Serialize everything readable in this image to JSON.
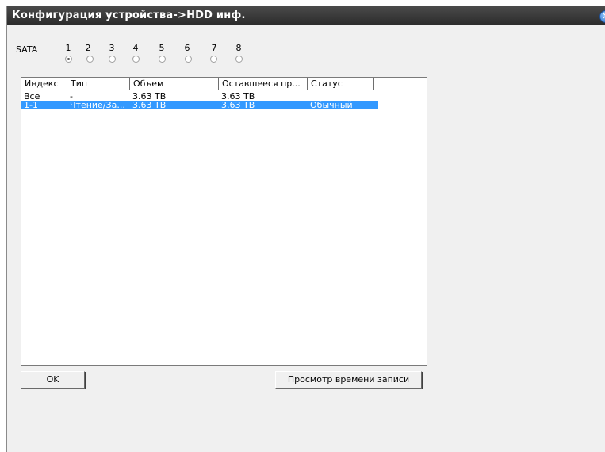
{
  "window": {
    "title": "Конфигурация устройства->HDD инф."
  },
  "sata": {
    "label": "SATA",
    "ports": [
      "1",
      "2",
      "3",
      "4",
      "5",
      "6",
      "7",
      "8"
    ],
    "selected_index": 0
  },
  "table": {
    "columns": [
      "Индекс",
      "Тип",
      "Объем",
      "Оставшееся пр...",
      "Статус"
    ],
    "rows": [
      {
        "index": "Все",
        "type": "-",
        "capacity": "3.63 TB",
        "remaining": "3.63 TB",
        "status": ""
      },
      {
        "index": "1-1",
        "type": "Чтение/За...",
        "capacity": "3.63 TB",
        "remaining": "3.63 TB",
        "status": "Обычный"
      }
    ],
    "selected_row": 1
  },
  "buttons": {
    "ok": "OK",
    "view_record_time": "Просмотр времени записи"
  },
  "icons": {
    "close": "close-icon"
  }
}
